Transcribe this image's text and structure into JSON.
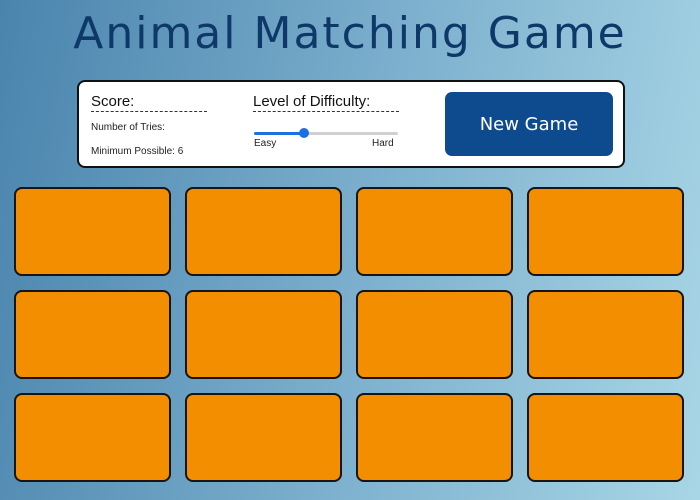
{
  "title": "Animal Matching Game",
  "score": {
    "label": "Score:",
    "tries_label": "Number of Tries:",
    "minimum_label": "Minimum Possible: 6"
  },
  "difficulty": {
    "label": "Level of Difficulty:",
    "min_label": "Easy",
    "max_label": "Hard",
    "level": 0.35,
    "accent_color": "#1e6fe0"
  },
  "new_game_button": {
    "label": "New Game",
    "color": "#0e4a8e"
  },
  "board": {
    "rows": 3,
    "columns": 4,
    "card_back_color": "#f28e00",
    "cards": [
      {
        "state": "face-down"
      },
      {
        "state": "face-down"
      },
      {
        "state": "face-down"
      },
      {
        "state": "face-down"
      },
      {
        "state": "face-down"
      },
      {
        "state": "face-down"
      },
      {
        "state": "face-down"
      },
      {
        "state": "face-down"
      },
      {
        "state": "face-down"
      },
      {
        "state": "face-down"
      },
      {
        "state": "face-down"
      },
      {
        "state": "face-down"
      }
    ]
  }
}
